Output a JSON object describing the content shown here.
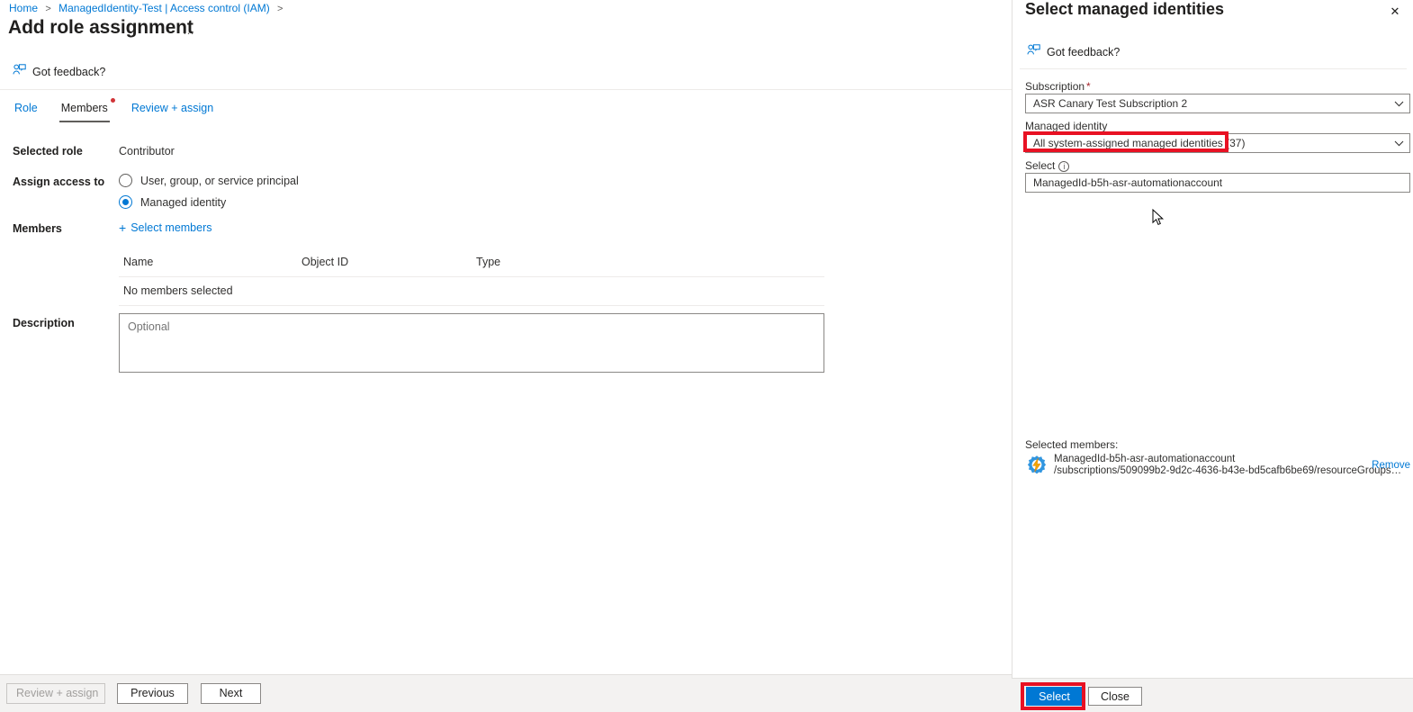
{
  "breadcrumb": {
    "items": [
      {
        "label": "Home",
        "link": true
      },
      {
        "label": "ManagedIdentity-Test | Access control (IAM)",
        "link": true
      }
    ],
    "separator": ">"
  },
  "page": {
    "title": "Add role assignment",
    "overflow_label": "…",
    "feedback_label": "Got feedback?"
  },
  "tabs": [
    {
      "label": "Role",
      "active": false,
      "required_dot": false
    },
    {
      "label": "Members",
      "active": true,
      "required_dot": true
    },
    {
      "label": "Review + assign",
      "active": false,
      "required_dot": false
    }
  ],
  "form": {
    "selected_role_label": "Selected role",
    "selected_role_value": "Contributor",
    "assign_access_label": "Assign access to",
    "assign_access_options": [
      {
        "label": "User, group, or service principal",
        "checked": false
      },
      {
        "label": "Managed identity",
        "checked": true
      }
    ],
    "members_label": "Members",
    "select_members_link": "Select members",
    "members_table": {
      "columns": [
        "Name",
        "Object ID",
        "Type"
      ],
      "empty_text": "No members selected",
      "rows": []
    },
    "description_label": "Description",
    "description_placeholder": "Optional",
    "description_value": ""
  },
  "footer": {
    "review_assign_label": "Review + assign",
    "review_assign_disabled": true,
    "previous_label": "Previous",
    "next_label": "Next"
  },
  "panel": {
    "title": "Select managed identities",
    "close_glyph": "✕",
    "feedback_label": "Got feedback?",
    "subscription_label": "Subscription",
    "subscription_required": "*",
    "subscription_value": "ASR Canary Test Subscription 2",
    "managed_identity_label": "Managed identity",
    "managed_identity_value": "All system-assigned managed identities (37)",
    "select_label": "Select",
    "select_info_glyph": "i",
    "select_value": "ManagedId-b5h-asr-automationaccount",
    "selected_members_label": "Selected members:",
    "selected_member": {
      "name": "ManagedId-b5h-asr-automationaccount",
      "subtitle": "/subscriptions/509099b2-9d2c-4636-b43e-bd5cafb6be69/resourceGroups…",
      "remove_label": "Remove",
      "icon": "managed-identity-icon"
    },
    "select_button_label": "Select",
    "close_button_label": "Close"
  },
  "colors": {
    "accent_blue": "#0078d4",
    "annotation_red": "#e81123",
    "required_red": "#a4262c",
    "tab_dot_red": "#d13438",
    "footer_gray": "#f3f2f1",
    "border_gray": "#8a8886",
    "text_dark": "#201f1e"
  }
}
